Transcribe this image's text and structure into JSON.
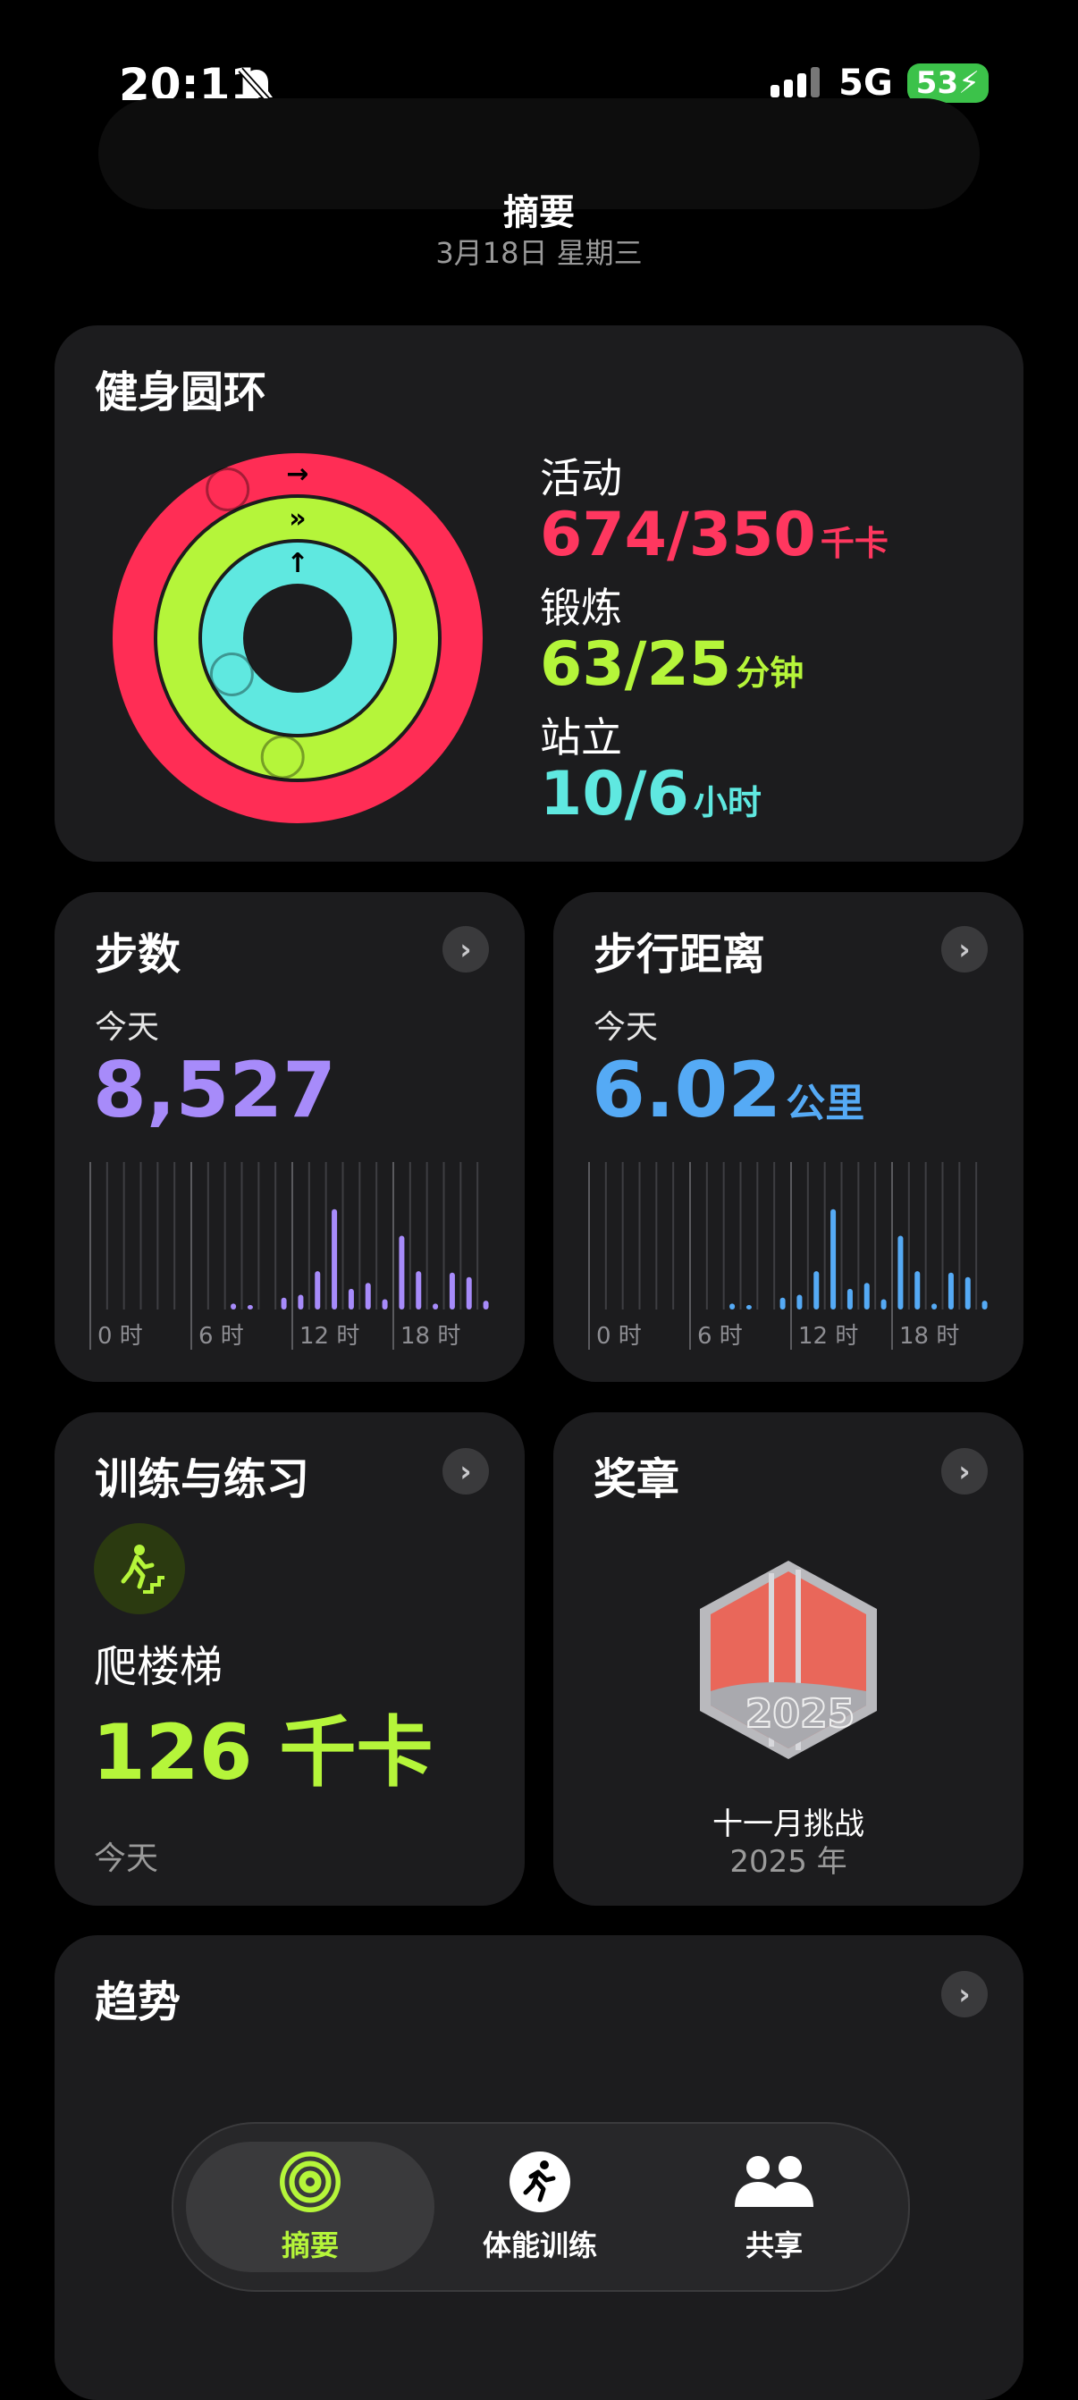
{
  "status_bar": {
    "time": "20:11",
    "network": "5G",
    "battery": "53"
  },
  "header": {
    "title": "摘要",
    "date": "3月18日 星期三"
  },
  "rings": {
    "title": "健身圆环",
    "move": {
      "label": "活动",
      "value": "674/350",
      "unit": "千卡",
      "color": "#ff2d55",
      "progress": 1.93
    },
    "exercise": {
      "label": "锻炼",
      "value": "63/25",
      "unit": "分钟",
      "color": "#b5f53a",
      "progress": 2.52
    },
    "stand": {
      "label": "站立",
      "value": "10/6",
      "unit": "小时",
      "color": "#5fe8e0",
      "progress": 1.67
    }
  },
  "steps": {
    "title": "步数",
    "period": "今天",
    "value": "8,527",
    "color": "#a78bfa",
    "x_labels": [
      "0 时",
      "6 时",
      "12 时",
      "18 时"
    ],
    "hourly": [
      0,
      0,
      0,
      0,
      0,
      0,
      0,
      0,
      0.04,
      0.03,
      0,
      0.08,
      0.1,
      0.26,
      0.68,
      0.14,
      0.18,
      0.07,
      0.5,
      0.26,
      0.04,
      0.25,
      0.22,
      0.06
    ]
  },
  "distance": {
    "title": "步行距离",
    "period": "今天",
    "value": "6.02",
    "unit": "公里",
    "color": "#55aaf5",
    "x_labels": [
      "0 时",
      "6 时",
      "12 时",
      "18 时"
    ],
    "hourly": [
      0,
      0,
      0,
      0,
      0,
      0,
      0,
      0,
      0.04,
      0.03,
      0,
      0.08,
      0.1,
      0.26,
      0.68,
      0.14,
      0.18,
      0.07,
      0.5,
      0.26,
      0.04,
      0.25,
      0.22,
      0.06
    ]
  },
  "workouts": {
    "title": "训练与练习",
    "activity": "爬楼梯",
    "value": "126 千卡",
    "period": "今天",
    "color": "#b5f53a",
    "icon": "stair-climbing-icon"
  },
  "awards": {
    "title": "奖章",
    "name": "十一月挑战",
    "year": "2025 年",
    "badge_text": "2025"
  },
  "trends": {
    "title": "趋势"
  },
  "tabs": [
    {
      "label": "摘要",
      "icon": "activity-rings-icon",
      "active": true
    },
    {
      "label": "体能训练",
      "icon": "runner-icon",
      "active": false
    },
    {
      "label": "共享",
      "icon": "people-icon",
      "active": false
    }
  ]
}
